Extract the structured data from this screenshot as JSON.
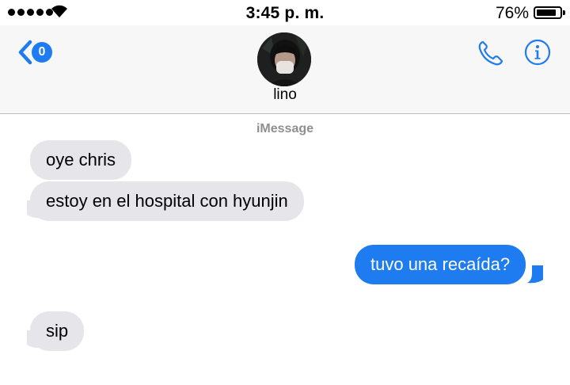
{
  "status_bar": {
    "time": "3:45 p. m.",
    "battery": "76%",
    "battery_level": 0.76,
    "signal_bars": 5
  },
  "header": {
    "back_badge": "0",
    "contact_name": "lino",
    "avatar": "contact-photo",
    "icons": [
      "back-chevron-icon",
      "phone-icon",
      "info-icon"
    ]
  },
  "conversation": {
    "service_label": "iMessage",
    "messages": [
      {
        "direction": "incoming",
        "text": "oye chris"
      },
      {
        "direction": "incoming",
        "text": "estoy en el hospital con hyunjin"
      },
      {
        "direction": "outgoing",
        "text": "tuvo una recaída?"
      },
      {
        "direction": "incoming",
        "text": "sip"
      }
    ]
  },
  "colors": {
    "accent": "#1e7cf0",
    "incoming_bubble": "#e5e5ea",
    "outgoing_bubble": "#1e7cf0",
    "header_background": "#f7f7f7",
    "service_label": "#8e8e93"
  }
}
